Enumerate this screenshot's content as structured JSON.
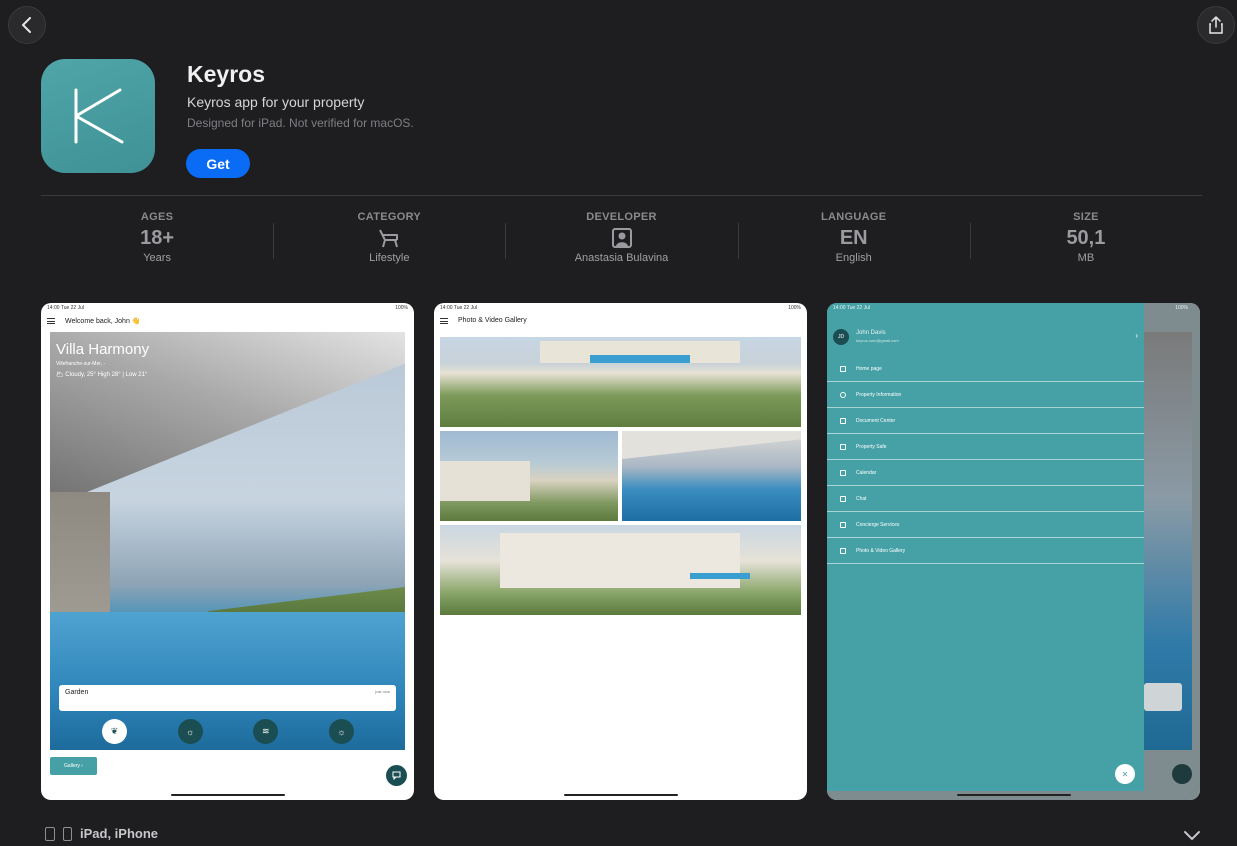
{
  "app": {
    "name": "Keyros",
    "subtitle": "Keyros app for your property",
    "note": "Designed for iPad. Not verified for macOS.",
    "get_label": "Get",
    "icon_letter": "K",
    "icon_color": "#45a1a6",
    "accent": "#0a6cf5"
  },
  "info": [
    {
      "label": "AGES",
      "value": "18+",
      "sub": "Years"
    },
    {
      "label": "CATEGORY",
      "icon": "armchair-icon",
      "sub": "Lifestyle"
    },
    {
      "label": "DEVELOPER",
      "icon": "person-icon",
      "sub": "Anastasia Bulavina"
    },
    {
      "label": "LANGUAGE",
      "value": "EN",
      "sub": "English"
    },
    {
      "label": "SIZE",
      "value": "50,1",
      "sub": "MB"
    }
  ],
  "shot1": {
    "time": "14:00",
    "date": "Tue 22 Jul",
    "battery": "100%",
    "greeting": "Welcome back, John 👋",
    "title": "Villa Harmony",
    "location": "Villefranche-sur-Mer, -",
    "weather": "🌥 Cloudy, 25°  High 28° | Low 21°",
    "card_title": "Garden",
    "card_time": "just now",
    "gallery_label": "Gallery ›"
  },
  "shot2": {
    "time": "14:00",
    "date": "Tue 22 Jul",
    "battery": "100%",
    "title": "Photo & Video Gallery"
  },
  "shot3": {
    "time": "14:00",
    "date": "Tue 22 Jul",
    "battery": "100%",
    "user_initials": "JD",
    "user_name": "John Davis",
    "user_email": "keyros.com@gmail.com",
    "menu": [
      "Home page",
      "Property Information",
      "Document Center",
      "Property Safe",
      "Calendar",
      "Chat",
      "Concierge Services",
      "Photo & Video Gallery"
    ]
  },
  "footer": {
    "devices": "iPad, iPhone"
  }
}
